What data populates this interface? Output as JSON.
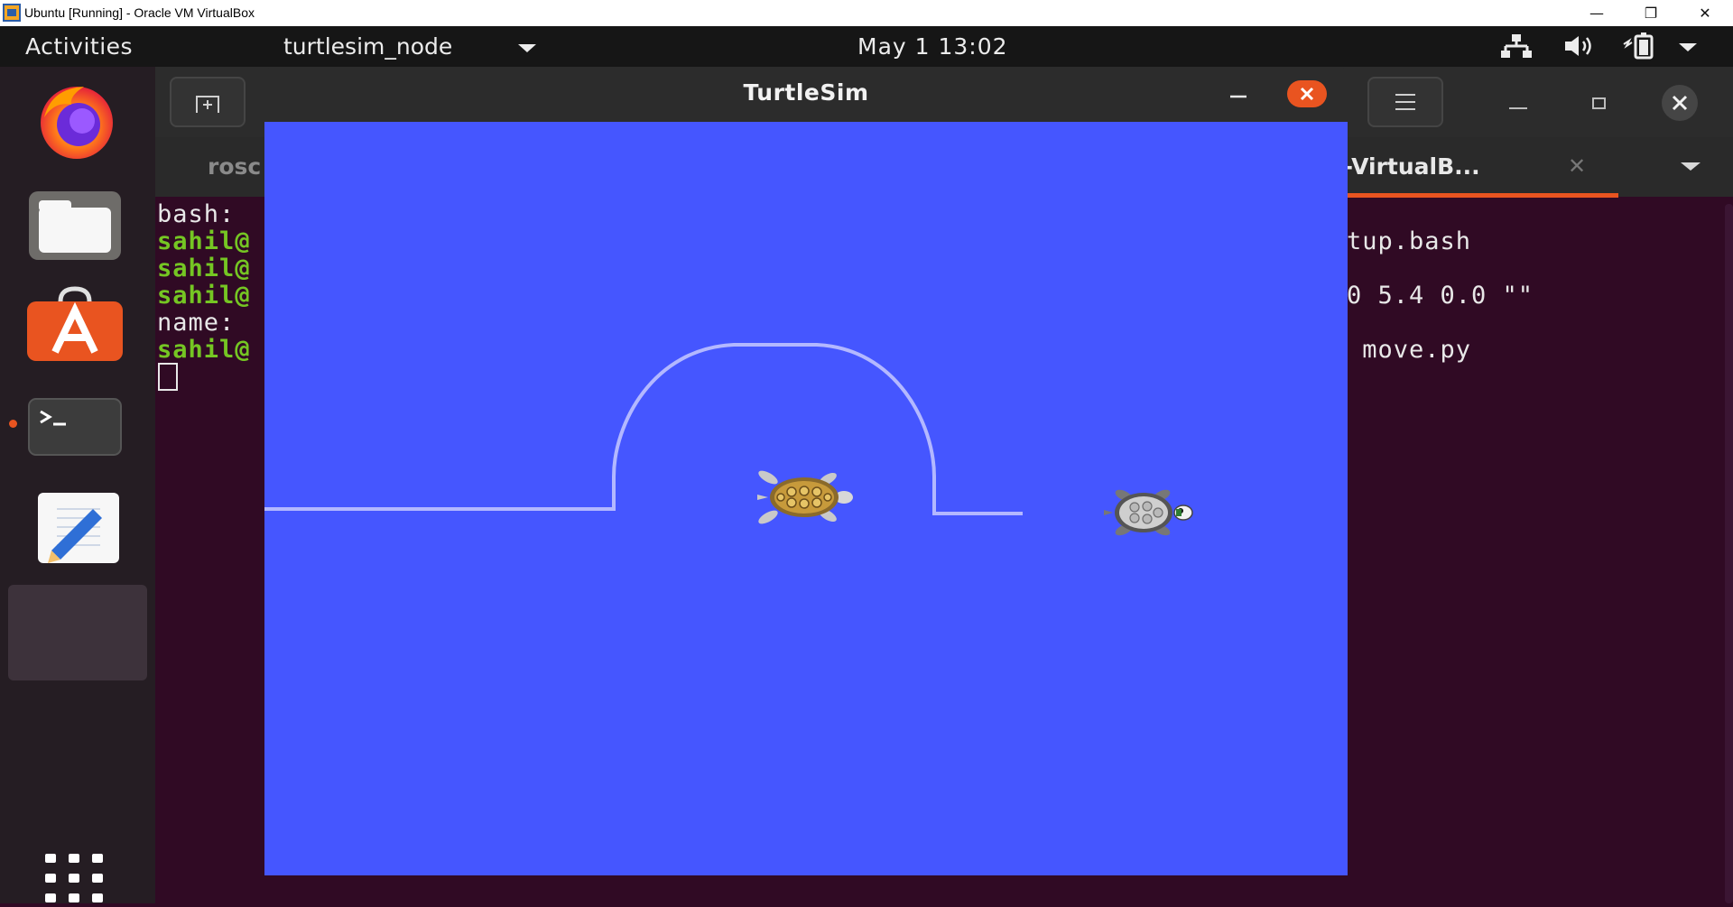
{
  "host_window": {
    "title": "Ubuntu [Running] - Oracle VM VirtualBox",
    "minimize_glyph": "—",
    "restore_glyph": "❐",
    "close_glyph": "✕"
  },
  "top_bar": {
    "activities": "Activities",
    "app_menu": "turtlesim_node",
    "clock": "May 1  13:02",
    "tray_icons": [
      "network-icon",
      "volume-icon",
      "battery-icon",
      "system-menu-arrow-icon"
    ]
  },
  "dock": {
    "items": [
      "firefox-icon",
      "files-icon",
      "ubuntu-software-icon",
      "terminal-icon",
      "text-editor-icon",
      "active-app-slot"
    ],
    "show_apps": "show-applications-icon"
  },
  "terminal": {
    "tabs": [
      {
        "label": "rosc",
        "active": false
      },
      {
        "label": "l-VirtualB...",
        "active": true
      }
    ],
    "tab_close_glyph": "✕",
    "lines_left": [
      "bash:",
      "sahil@",
      "sahil@",
      "sahil@",
      "name:",
      "sahil@"
    ],
    "lines_right": [
      {
        "row": 1,
        "text": "tup.bash"
      },
      {
        "row": 3,
        "text": "0 5.4 0.0 \"\""
      },
      {
        "row": 5,
        "text": " move.py"
      }
    ]
  },
  "turtlesim": {
    "title": "TurtleSim",
    "background_color": "#4556ff",
    "pen_color": "#b3b8ff",
    "turtles": [
      "turtle1-icon",
      "turtle2-icon"
    ]
  },
  "colors": {
    "ubuntu_orange": "#e95420",
    "terminal_bg": "#300a24",
    "prompt_green": "#75c623"
  }
}
